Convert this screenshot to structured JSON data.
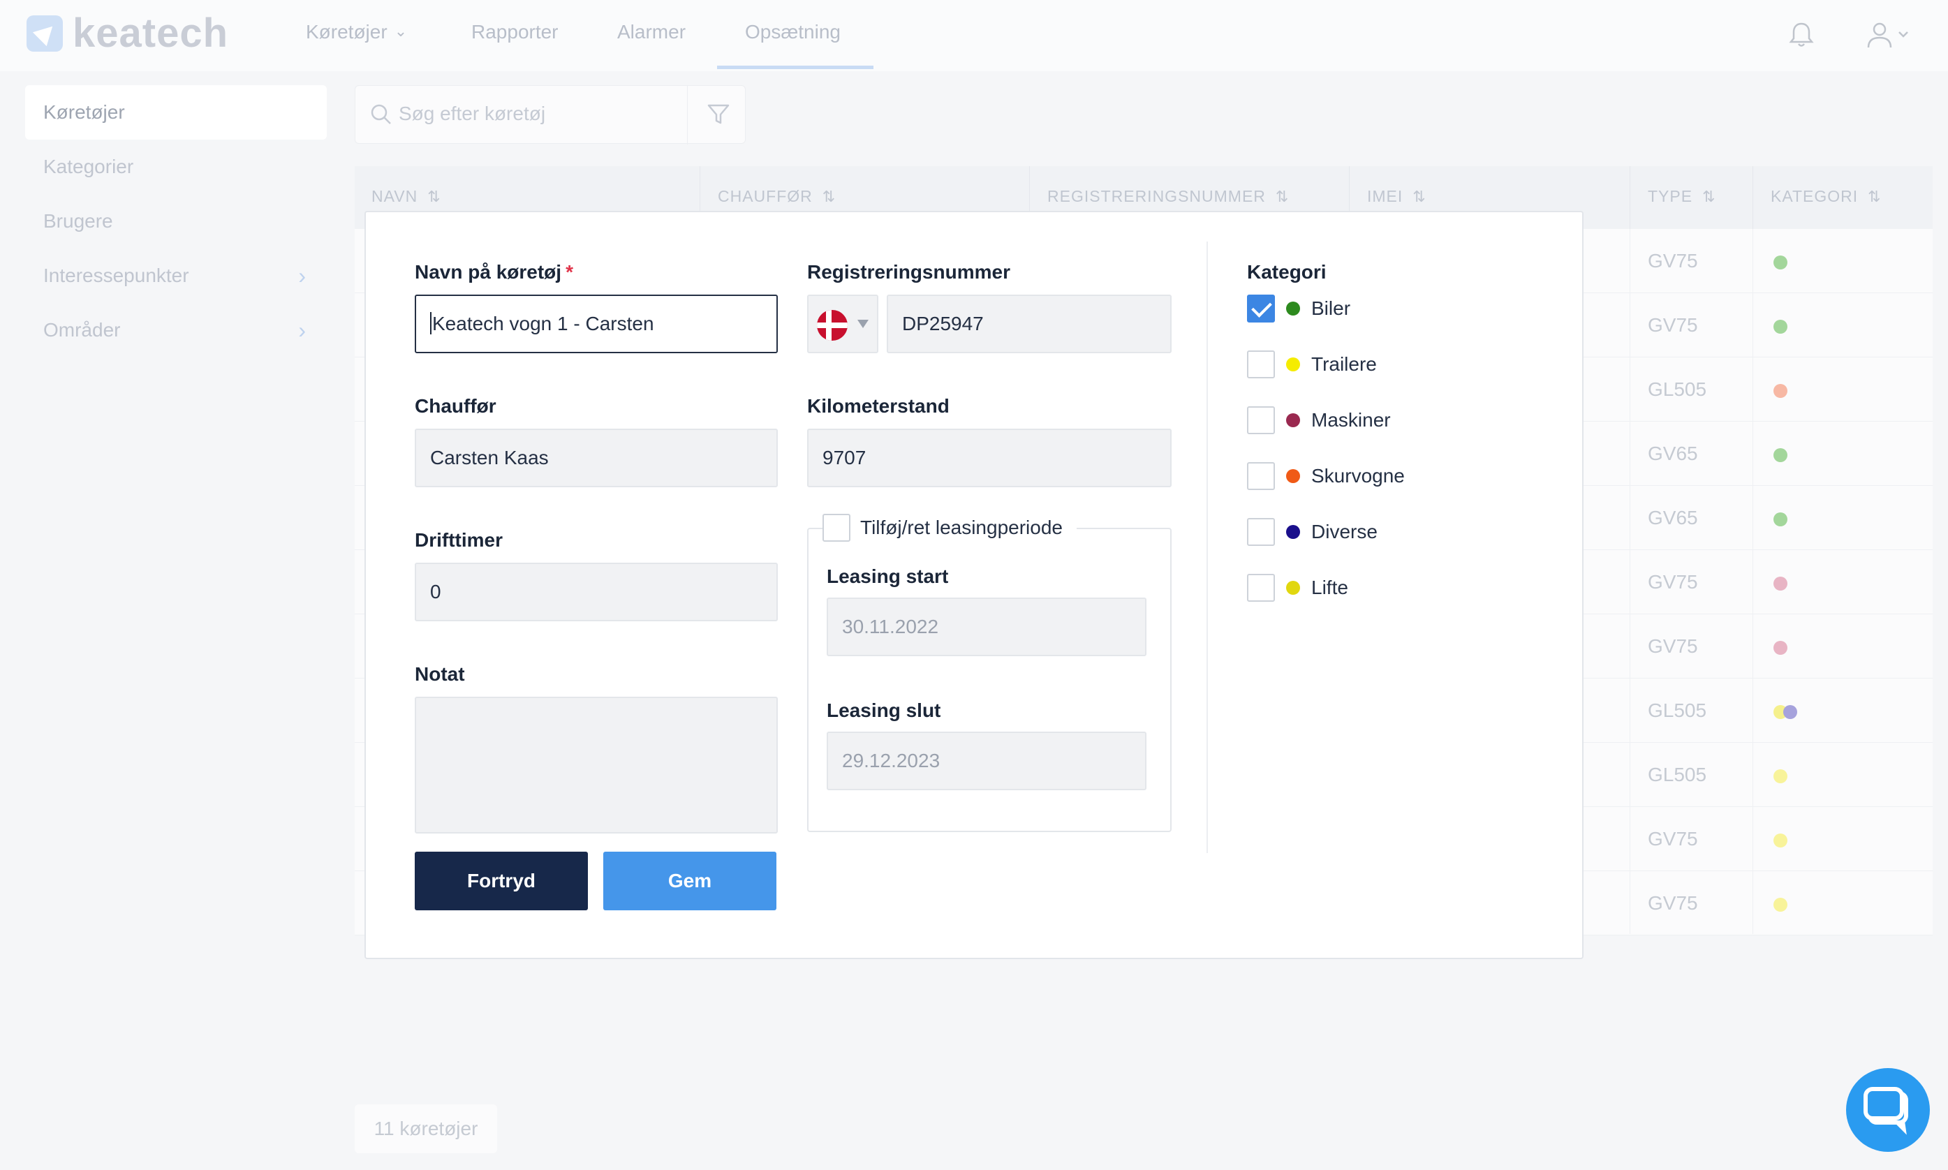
{
  "brand": {
    "name": "keatech"
  },
  "nav": {
    "items": [
      {
        "label": "Køretøjer",
        "has_dropdown": true
      },
      {
        "label": "Rapporter"
      },
      {
        "label": "Alarmer"
      },
      {
        "label": "Opsætning",
        "active": true
      }
    ]
  },
  "sidebar": {
    "items": [
      {
        "label": "Køretøjer",
        "active": true
      },
      {
        "label": "Kategorier"
      },
      {
        "label": "Brugere"
      },
      {
        "label": "Interessepunkter",
        "has_arrow": true
      },
      {
        "label": "Områder",
        "has_arrow": true
      }
    ]
  },
  "search": {
    "placeholder": "Søg efter køretøj"
  },
  "table": {
    "headers": [
      "NAVN",
      "CHAUFFØR",
      "REGISTRERINGSNUMMER",
      "IMEI",
      "TYPE",
      "KATEGORI"
    ],
    "rows": [
      {
        "type": "GV75",
        "cat_colors": [
          "#a3d69b"
        ]
      },
      {
        "type": "GV75",
        "cat_colors": [
          "#a3d69b"
        ]
      },
      {
        "type": "GL505",
        "cat_colors": [
          "#f7b8a4"
        ]
      },
      {
        "type": "GV65",
        "cat_colors": [
          "#a3d69b"
        ]
      },
      {
        "type": "GV65",
        "cat_colors": [
          "#a3d69b"
        ]
      },
      {
        "type": "GV75",
        "cat_colors": [
          "#e8b4c4"
        ]
      },
      {
        "type": "GV75",
        "cat_colors": [
          "#e8b4c4"
        ]
      },
      {
        "type": "GL505",
        "cat_colors": [
          "#f5f08c",
          "#a6a2dc"
        ]
      },
      {
        "type": "GL505",
        "cat_colors": [
          "#f8f39a"
        ]
      },
      {
        "type": "GV75",
        "cat_colors": [
          "#f8f39a"
        ]
      },
      {
        "type": "GV75",
        "cat_colors": [
          "#f8f39a"
        ]
      }
    ],
    "count_label": "11 køretøjer"
  },
  "form": {
    "name_label": "Navn på køretøj",
    "name_required": "*",
    "name_value": "Keatech vogn 1 - Carsten",
    "reg_label": "Registreringsnummer",
    "reg_value": "DP25947",
    "country_flag": "dk-flag-icon",
    "driver_label": "Chauffør",
    "driver_value": "Carsten Kaas",
    "odometer_label": "Kilometerstand",
    "odometer_value": "9707",
    "hours_label": "Drifttimer",
    "hours_value": "0",
    "note_label": "Notat",
    "note_value": "",
    "leasing_toggle_label": "Tilføj/ret leasingperiode",
    "leasing_start_label": "Leasing start",
    "leasing_start_value": "30.11.2022",
    "leasing_end_label": "Leasing slut",
    "leasing_end_value": "29.12.2023",
    "category_label": "Kategori",
    "categories": [
      {
        "label": "Biler",
        "color": "#2d8a1e",
        "checked": true
      },
      {
        "label": "Trailere",
        "color": "#f5ec00",
        "checked": false
      },
      {
        "label": "Maskiner",
        "color": "#9a2950",
        "checked": false
      },
      {
        "label": "Skurvogne",
        "color": "#f05a16",
        "checked": false
      },
      {
        "label": "Diverse",
        "color": "#1a0f8c",
        "checked": false
      },
      {
        "label": "Lifte",
        "color": "#e1d70f",
        "checked": false
      }
    ],
    "cancel_label": "Fortryd",
    "save_label": "Gem"
  }
}
